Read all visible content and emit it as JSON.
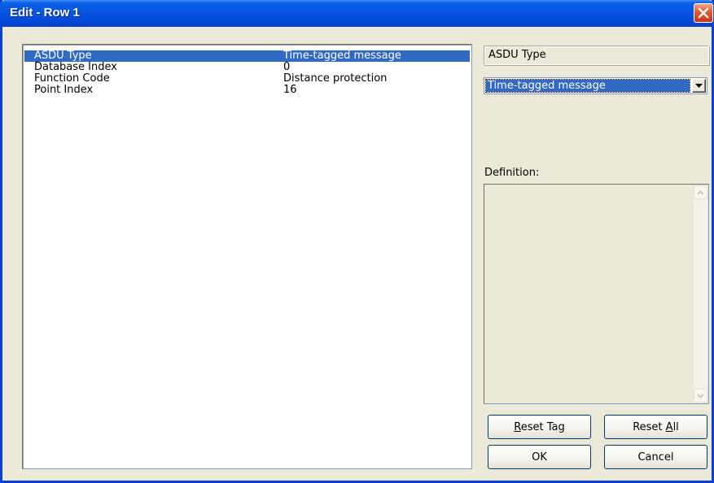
{
  "window": {
    "title": "Edit - Row 1",
    "close_icon": "close-icon"
  },
  "properties": {
    "rows": [
      {
        "name": "ASDU Type",
        "value": "Time-tagged message",
        "selected": true
      },
      {
        "name": "Database Index",
        "value": "0",
        "selected": false
      },
      {
        "name": "Function Code",
        "value": "Distance protection",
        "selected": false
      },
      {
        "name": "Point Index",
        "value": "16",
        "selected": false
      }
    ]
  },
  "editor": {
    "field_label": "ASDU Type",
    "combo_value": "Time-tagged message",
    "combo_arrow_icon": "chevron-down-icon",
    "definition_label": "Definition:",
    "definition_text": ""
  },
  "buttons": {
    "reset_tag": {
      "label": "Reset Tag",
      "mnemonic": "R"
    },
    "reset_all": {
      "label": "Reset All",
      "mnemonic": "A"
    },
    "ok": "OK",
    "cancel": "Cancel"
  },
  "colors": {
    "titlebar": "#0553dd",
    "selection": "#316ac5",
    "dialog_bg": "#ece9d8",
    "close_button": "#e0582c"
  }
}
